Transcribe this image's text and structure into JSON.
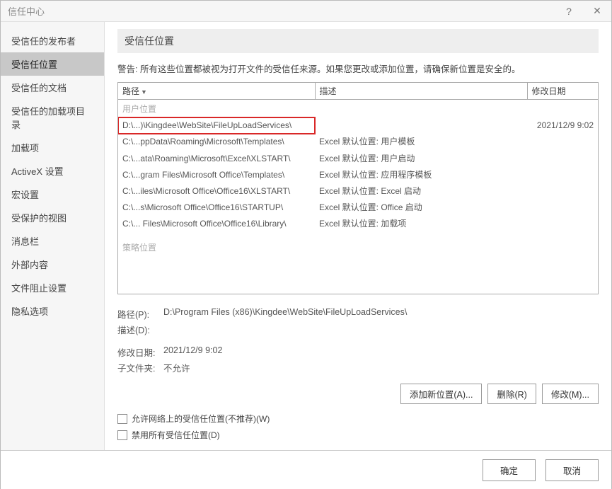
{
  "window": {
    "title": "信任中心"
  },
  "sidebar": {
    "items": [
      {
        "label": "受信任的发布者",
        "id": "trusted-publishers"
      },
      {
        "label": "受信任位置",
        "id": "trusted-locations",
        "selected": true
      },
      {
        "label": "受信任的文档",
        "id": "trusted-documents"
      },
      {
        "label": "受信任的加载项目录",
        "id": "trusted-catalogs"
      },
      {
        "label": "加载项",
        "id": "addins"
      },
      {
        "label": "ActiveX 设置",
        "id": "activex"
      },
      {
        "label": "宏设置",
        "id": "macro"
      },
      {
        "label": "受保护的视图",
        "id": "protected-view"
      },
      {
        "label": "消息栏",
        "id": "message-bar"
      },
      {
        "label": "外部内容",
        "id": "external-content"
      },
      {
        "label": "文件阻止设置",
        "id": "file-block"
      },
      {
        "label": "隐私选项",
        "id": "privacy"
      }
    ]
  },
  "page": {
    "heading": "受信任位置",
    "warning": "警告: 所有这些位置都被视为打开文件的受信任来源。如果您更改或添加位置，请确保新位置是安全的。",
    "columns": {
      "path": "路径",
      "desc": "描述",
      "date": "修改日期"
    },
    "section_user": "用户位置",
    "section_policy": "策略位置",
    "rows": [
      {
        "path": "D:\\...)\\Kingdee\\WebSite\\FileUpLoadServices\\",
        "desc": "",
        "date": "2021/12/9 9:02",
        "selected": true
      },
      {
        "path": "C:\\...ppData\\Roaming\\Microsoft\\Templates\\",
        "desc": "Excel 默认位置: 用户模板",
        "date": ""
      },
      {
        "path": "C:\\...ata\\Roaming\\Microsoft\\Excel\\XLSTART\\",
        "desc": "Excel 默认位置: 用户启动",
        "date": ""
      },
      {
        "path": "C:\\...gram Files\\Microsoft Office\\Templates\\",
        "desc": "Excel 默认位置: 应用程序模板",
        "date": ""
      },
      {
        "path": "C:\\...iles\\Microsoft Office\\Office16\\XLSTART\\",
        "desc": "Excel 默认位置: Excel 启动",
        "date": ""
      },
      {
        "path": "C:\\...s\\Microsoft Office\\Office16\\STARTUP\\",
        "desc": "Excel 默认位置: Office 启动",
        "date": ""
      },
      {
        "path": "C:\\... Files\\Microsoft Office\\Office16\\Library\\",
        "desc": "Excel 默认位置: 加载项",
        "date": ""
      }
    ]
  },
  "details": {
    "path_label": "路径(P):",
    "path_value": "D:\\Program Files (x86)\\Kingdee\\WebSite\\FileUpLoadServices\\",
    "desc_label": "描述(D):",
    "desc_value": "",
    "date_label": "修改日期:",
    "date_value": "2021/12/9 9:02",
    "subfolder_label": "子文件夹:",
    "subfolder_value": "不允许"
  },
  "buttons": {
    "add": "添加新位置(A)...",
    "remove": "删除(R)",
    "modify": "修改(M)..."
  },
  "checkboxes": {
    "allow_network": "允许网络上的受信任位置(不推荐)(W)",
    "disable_all": "禁用所有受信任位置(D)"
  },
  "dialog": {
    "ok": "确定",
    "cancel": "取消"
  }
}
